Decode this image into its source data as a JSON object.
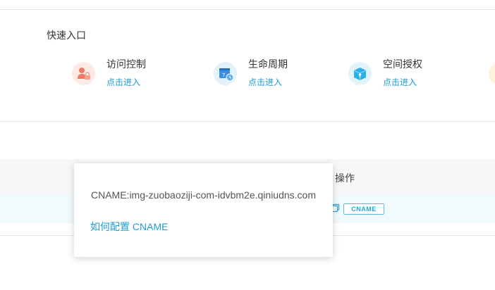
{
  "quick_entry": {
    "title": "快速入口",
    "items": [
      {
        "label": "访问控制",
        "link": "点击进入",
        "icon": "user-lock-icon",
        "icon_bg": "#fde9e6",
        "icon_color": "#f07864"
      },
      {
        "label": "生命周期",
        "link": "点击进入",
        "icon": "calendar-clock-icon",
        "icon_bg": "#e3f1fb",
        "icon_color": "#3a8ee0"
      },
      {
        "label": "空间授权",
        "link": "点击进入",
        "icon": "box-key-icon",
        "icon_bg": "#e1f4fb",
        "icon_color": "#27b1e6"
      }
    ]
  },
  "table": {
    "operation_header": "操作",
    "row": {
      "cname_button": "CNAME"
    }
  },
  "popover": {
    "cname_text": "CNAME:img-zuobaoziji-com-idvbm2e.qiniudns.com",
    "help_link": "如何配置 CNAME"
  },
  "colors": {
    "accent": "#1f9bd8",
    "divider": "#e8e8e8",
    "row_highlight": "#f2fafd"
  }
}
